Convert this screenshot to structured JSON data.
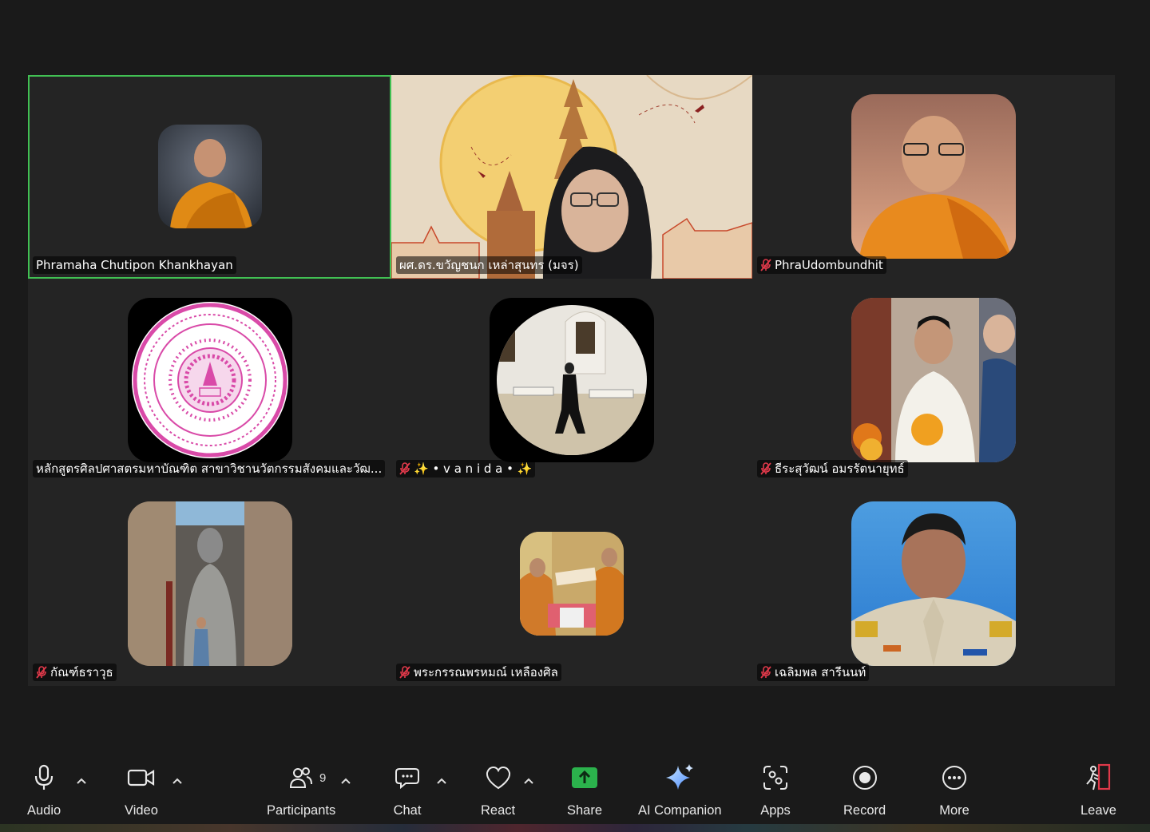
{
  "participants": [
    {
      "name": "Phramaha Chutipon Khankhayan",
      "muted": false,
      "active": true,
      "avatar": "monk-portrait"
    },
    {
      "name": "ผศ.ดร.ขวัญชนก เหล่าสุนทร (มจร)",
      "muted": false,
      "active": false,
      "avatar": "video-feed"
    },
    {
      "name": "PhraUdombundhit",
      "muted": true,
      "active": false,
      "avatar": "monk-portrait"
    },
    {
      "name": "หลักสูตรศิลปศาสตรมหาบัณฑิต สาขาวิชานวัตกรรมสังคมและวัฒ...",
      "muted": false,
      "active": false,
      "avatar": "university-seal"
    },
    {
      "name": "✨ • v a n i d a • ✨",
      "muted": true,
      "active": false,
      "avatar": "person-walking"
    },
    {
      "name": "ธีระสุวัฒน์ อมรรัตนายุทธ์",
      "muted": true,
      "active": false,
      "avatar": "person-ceremony"
    },
    {
      "name": "กัณฑ์ธราวุธ",
      "muted": true,
      "active": false,
      "avatar": "buddha-statue"
    },
    {
      "name": "พระกรรณพรหมณ์ เหลืองศิล",
      "muted": true,
      "active": false,
      "avatar": "certificate-ceremony"
    },
    {
      "name": "เฉลิมพล สารีนนท์",
      "muted": true,
      "active": false,
      "avatar": "officer-portrait"
    }
  ],
  "toolbar": {
    "audio": "Audio",
    "video": "Video",
    "participants": "Participants",
    "participants_count": "9",
    "chat": "Chat",
    "react": "React",
    "share": "Share",
    "ai_companion": "AI Companion",
    "apps": "Apps",
    "record": "Record",
    "more": "More",
    "leave": "Leave"
  },
  "colors": {
    "active_border": "#41c053",
    "share_green": "#2bb24c",
    "leave_red": "#e0394a",
    "ai_blue": "#7fb8ff"
  }
}
